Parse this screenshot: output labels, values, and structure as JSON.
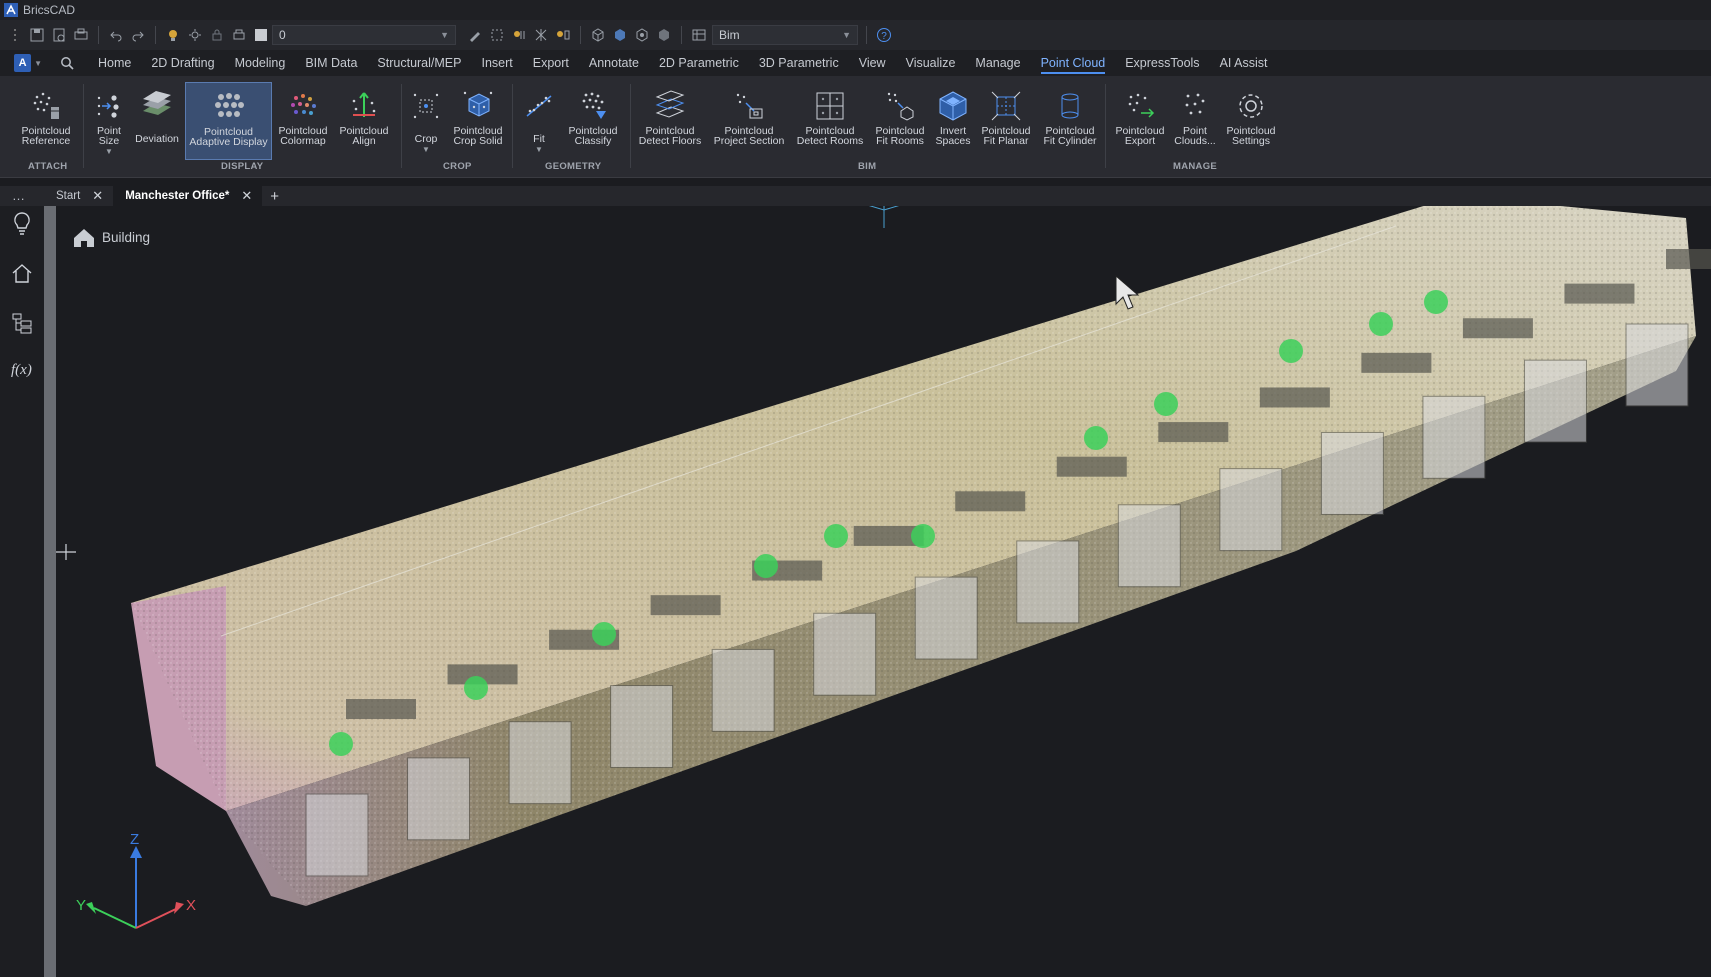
{
  "window": {
    "title": "BricsCAD"
  },
  "quick_access": {
    "layer_value": "0",
    "workspace_value": "Bim"
  },
  "menu_tabs": [
    {
      "label": "Home"
    },
    {
      "label": "2D Drafting"
    },
    {
      "label": "Modeling"
    },
    {
      "label": "BIM Data"
    },
    {
      "label": "Structural/MEP"
    },
    {
      "label": "Insert"
    },
    {
      "label": "Export"
    },
    {
      "label": "Annotate"
    },
    {
      "label": "2D Parametric"
    },
    {
      "label": "3D Parametric"
    },
    {
      "label": "View"
    },
    {
      "label": "Visualize"
    },
    {
      "label": "Manage"
    },
    {
      "label": "Point Cloud",
      "active": true
    },
    {
      "label": "ExpressTools"
    },
    {
      "label": "AI Assist"
    }
  ],
  "ribbon": {
    "groups": {
      "attach": "ATTACH",
      "display": "DISPLAY",
      "crop": "CROP",
      "geometry": "GEOMETRY",
      "bim": "BIM",
      "manage": "MANAGE"
    },
    "buttons": {
      "pointcloud_reference": "Pointcloud\nReference",
      "point_size": "Point\nSize",
      "deviation": "Deviation",
      "adaptive_display": "Pointcloud\nAdaptive Display",
      "colormap": "Pointcloud\nColormap",
      "align": "Pointcloud\nAlign",
      "crop": "Crop",
      "crop_solid": "Pointcloud\nCrop Solid",
      "fit": "Fit",
      "classify": "Pointcloud\nClassify",
      "detect_floors": "Pointcloud\nDetect Floors",
      "project_section": "Pointcloud\nProject Section",
      "detect_rooms": "Pointcloud\nDetect Rooms",
      "fit_rooms": "Pointcloud\nFit Rooms",
      "invert_spaces": "Invert\nSpaces",
      "fit_planar": "Pointcloud\nFit Planar",
      "fit_cylinder": "Pointcloud\nFit Cylinder",
      "export": "Pointcloud\nExport",
      "point_clouds": "Point\nClouds...",
      "settings": "Pointcloud\nSettings"
    }
  },
  "document_tabs": [
    {
      "label": "Start"
    },
    {
      "label": "Manchester Office*",
      "active": true
    }
  ],
  "viewport": {
    "breadcrumb": "Building",
    "axes": {
      "x": "X",
      "y": "Y",
      "z": "Z"
    }
  },
  "colors": {
    "accent": "#4d8ff0",
    "background": "#1b1c20",
    "cloud_beige": "#c9c09a",
    "cloud_pink": "#c9a3b8",
    "marker_green": "#3cd05a"
  }
}
